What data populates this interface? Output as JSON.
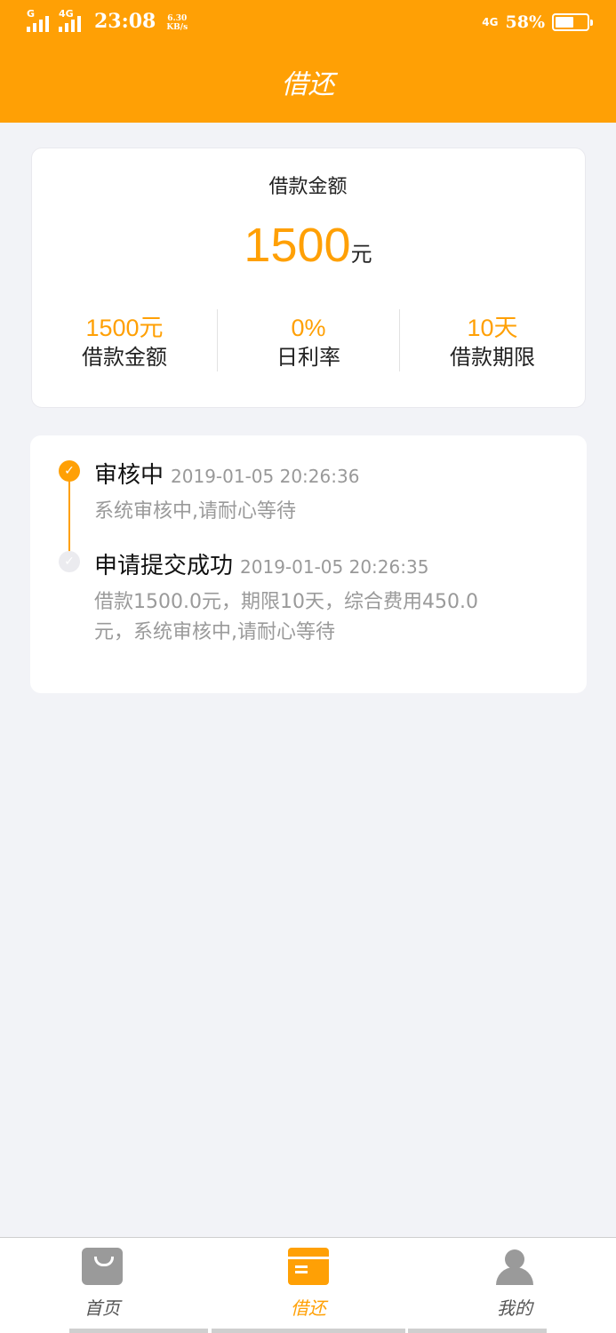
{
  "status_bar": {
    "sim1": "G",
    "sim2": "4G",
    "time": "23:08",
    "speed_value": "6.30",
    "speed_unit": "KB/s",
    "network": "4G",
    "battery": "58%",
    "battery_level": 0.58
  },
  "header": {
    "title": "借还"
  },
  "loan_card": {
    "label": "借款金额",
    "amount": "1500",
    "unit": "元",
    "stats": [
      {
        "value": "1500元",
        "label": "借款金额"
      },
      {
        "value": "0%",
        "label": "日利率"
      },
      {
        "value": "10天",
        "label": "借款期限"
      }
    ]
  },
  "timeline": [
    {
      "title": "审核中",
      "time": "2019-01-05 20:26:36",
      "desc": "系统审核中,请耐心等待",
      "state": "active"
    },
    {
      "title": "申请提交成功",
      "time": "2019-01-05 20:26:35",
      "desc": "借款1500.0元，期限10天，综合费用450.0元，系统审核中,请耐心等待",
      "state": "done"
    }
  ],
  "tabbar": {
    "items": [
      {
        "label": "首页",
        "icon": "shopping-bag-icon",
        "color": "#9a9a9a"
      },
      {
        "label": "借还",
        "icon": "bill-card-icon",
        "color": "#ffa005"
      },
      {
        "label": "我的",
        "icon": "person-icon",
        "color": "#9a9a9a"
      }
    ]
  },
  "colors": {
    "accent": "#ffa005",
    "background": "#f2f3f7"
  }
}
